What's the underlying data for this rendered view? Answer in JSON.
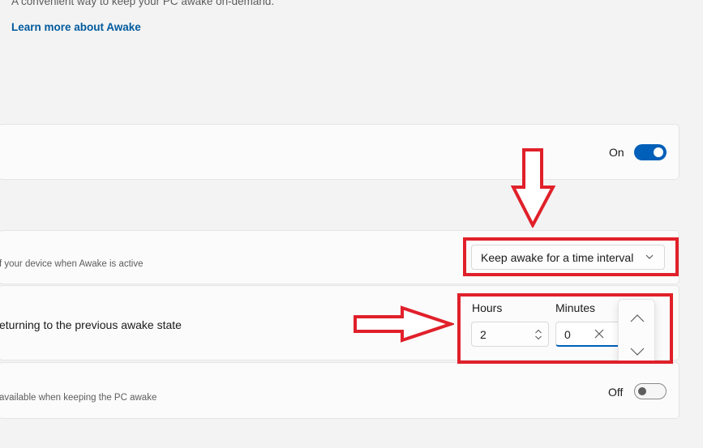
{
  "header": {
    "description": "A convenient way to keep your PC awake on-demand.",
    "learn_more_link": "Learn more about Awake"
  },
  "enable_row": {
    "state_label": "On",
    "toggle_on": true
  },
  "mode_row": {
    "description_partial": "f your device when Awake is active",
    "dropdown_selected": "Keep awake for a time interval"
  },
  "interval_row": {
    "title_partial": "eturning to the previous awake state",
    "hours_label": "Hours",
    "hours_value": "2",
    "minutes_label": "Minutes",
    "minutes_value": "0"
  },
  "screen_row": {
    "description_partial": "available when keeping the PC awake",
    "state_label": "Off",
    "toggle_on": false
  },
  "colors": {
    "accent": "#005fb8",
    "link": "#005a9e",
    "annotation": "#e0202a",
    "background": "#f3f3f3",
    "card": "#fbfbfb"
  },
  "icons": {
    "dropdown": "chevron-down-icon",
    "hours_spinner": "up-down-spinner-icon",
    "minutes_clear": "close-icon",
    "spin_up": "chevron-up-icon",
    "spin_down": "chevron-down-icon",
    "annotation_arrows": "red-arrow-icon"
  }
}
